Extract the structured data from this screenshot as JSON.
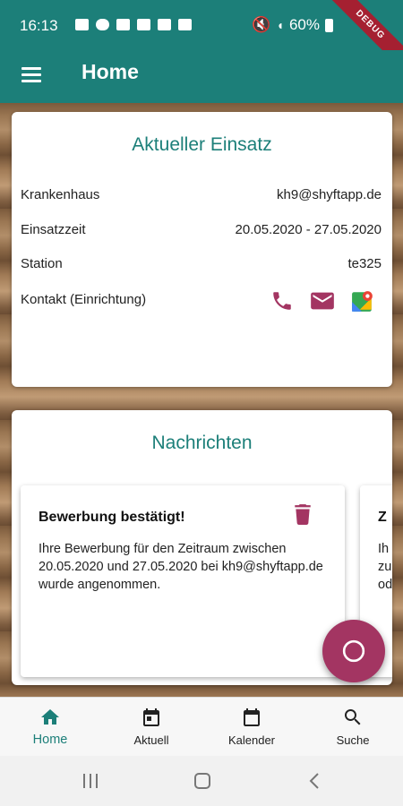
{
  "status": {
    "time": "16:13",
    "battery": "60%",
    "debug": "DEBUG"
  },
  "appbar": {
    "title": "Home"
  },
  "einsatz": {
    "title": "Aktueller Einsatz",
    "rows": [
      {
        "label": "Krankenhaus",
        "value": "kh9@shyftapp.de"
      },
      {
        "label": "Einsatzzeit",
        "value": "20.05.2020 - 27.05.2020"
      },
      {
        "label": "Station",
        "value": "te325"
      },
      {
        "label": "Kontakt (Einrichtung)",
        "value": ""
      }
    ],
    "contact_icons": [
      "phone-icon",
      "mail-icon",
      "maps-icon"
    ]
  },
  "nachrichten": {
    "title": "Nachrichten",
    "messages": [
      {
        "title": "Bewerbung bestätigt!",
        "body": "Ihre Bewerbung für den Zeitraum zwischen 20.05.2020 und 27.05.2020 bei kh9@shyftapp.de wurde angenommen."
      }
    ],
    "peek": {
      "title": "Z",
      "body_lines": [
        "Ih",
        "zu",
        "od"
      ]
    }
  },
  "bottom_nav": {
    "items": [
      {
        "label": "Home",
        "icon": "home-icon",
        "active": true
      },
      {
        "label": "Aktuell",
        "icon": "calendar-today-icon",
        "active": false
      },
      {
        "label": "Kalender",
        "icon": "calendar-icon",
        "active": false
      },
      {
        "label": "Suche",
        "icon": "search-icon",
        "active": false
      }
    ]
  },
  "colors": {
    "primary": "#1c7f79",
    "accent": "#a33562"
  }
}
